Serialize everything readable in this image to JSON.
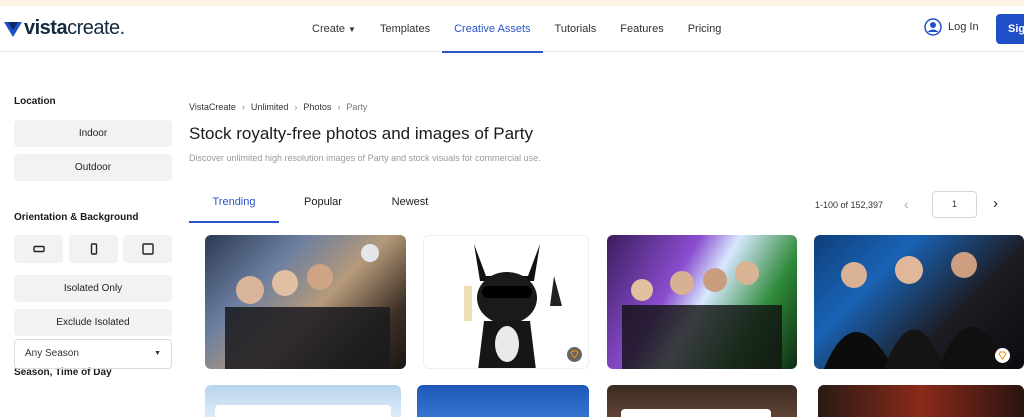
{
  "brand": {
    "name_bold": "vista",
    "name_light": "create.",
    "mark_color": "#1f4fc7"
  },
  "nav": {
    "items": [
      {
        "label": "Create",
        "has_dropdown": true,
        "active": false
      },
      {
        "label": "Templates",
        "active": false
      },
      {
        "label": "Creative Assets",
        "active": true
      },
      {
        "label": "Tutorials",
        "active": false
      },
      {
        "label": "Features",
        "active": false
      },
      {
        "label": "Pricing",
        "active": false
      }
    ],
    "login_label": "Log In",
    "signup_label": "Sig"
  },
  "sidebar": {
    "location_heading": "Location",
    "location_options": [
      "Indoor",
      "Outdoor"
    ],
    "orientation_heading": "Orientation & Background",
    "orientation_icons": [
      "horizontal-orientation-icon",
      "vertical-orientation-icon",
      "square-orientation-icon"
    ],
    "isolation_options": [
      "Isolated Only",
      "Exclude Isolated"
    ],
    "season_heading": "Season, Time of Day",
    "season_select_value": "Any Season"
  },
  "breadcrumb": [
    "VistaCreate",
    "Unlimited",
    "Photos",
    "Party"
  ],
  "page": {
    "title": "Stock royalty-free photos and images of Party",
    "subtitle": "Discover unlimited high resolution images of Party and stock visuals for commercial use."
  },
  "tabs": [
    {
      "label": "Trending",
      "active": true
    },
    {
      "label": "Popular",
      "active": false
    },
    {
      "label": "Newest",
      "active": false
    }
  ],
  "pagination": {
    "range_text": "1-100 of 152,397",
    "page_value": "1"
  },
  "colors": {
    "accent": "#2a55c9",
    "premium": "#f39200"
  }
}
